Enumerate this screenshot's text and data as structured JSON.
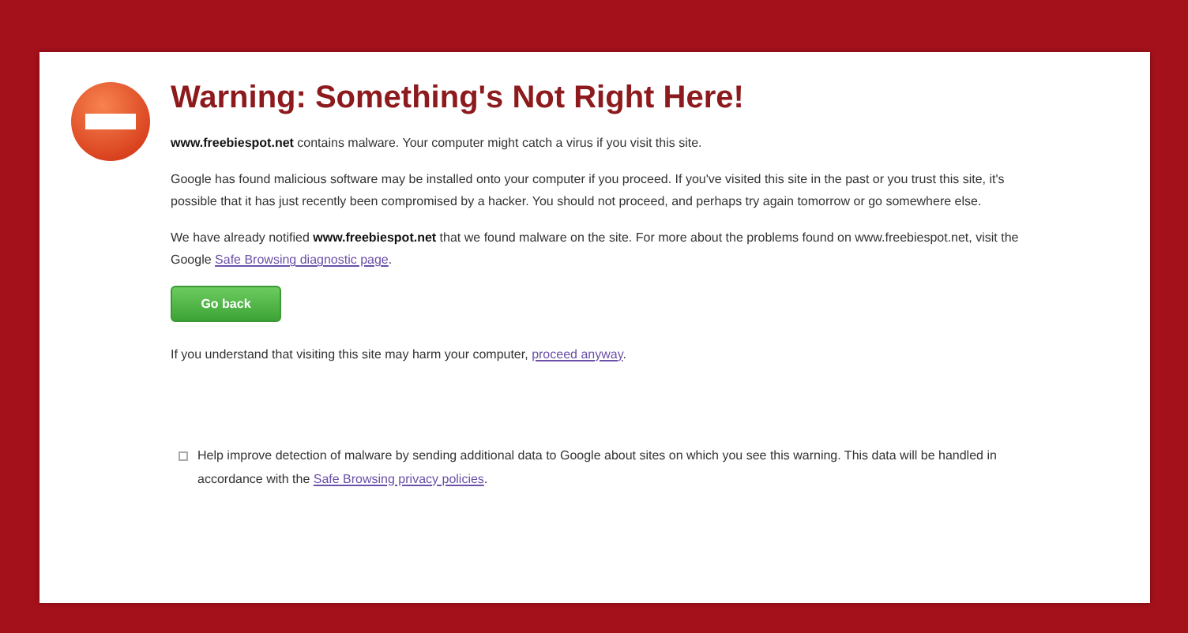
{
  "title": "Warning: Something's Not Right Here!",
  "paragraphs": [
    {
      "text": "**www.freebiespot.net** contains malware. Your computer might catch a virus if you visit this site."
    },
    {
      "text": "Google has found malicious software may be installed onto your computer if you proceed. If you've visited this site in the past or you trust this site, it's possible that it has just recently been compromised by a hacker. You should not proceed, and perhaps try again tomorrow or go somewhere else."
    },
    {
      "text": "We have already notified **www.freebiespot.net** that we found malware on the site. For more about the problems found on www.freebiespot.net, visit the Google ",
      "link": "Safe Browsing diagnostic page",
      "after": "."
    }
  ],
  "button": "Go back",
  "proceed": {
    "text": "If you understand that visiting this site may harm your computer, ",
    "link": "proceed anyway",
    "after": "."
  },
  "report": {
    "checked": false,
    "text": "Help improve detection of malware by sending additional data to Google about sites on which you see this warning. This data will be handled in accordance with the ",
    "link": "Safe Browsing privacy policies",
    "after": "."
  }
}
